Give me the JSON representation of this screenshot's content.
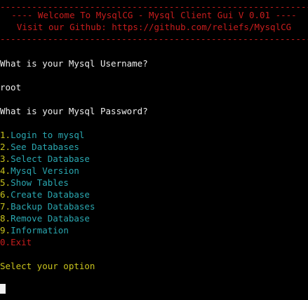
{
  "banner": {
    "rule_top": "------------------------------------------------------------",
    "welcome": "---- Welcome To MysqlCG - Mysql Client Gui V 0.01 ----",
    "github": "Visit our Github: https://github.com/reliefs/MysqlCG",
    "rule_bottom": "------------------------------------------------------------"
  },
  "prompts": {
    "username_question": "What is your Mysql Username?",
    "username_answer": "root",
    "password_question": "What is your Mysql Password?"
  },
  "menu": [
    {
      "num": "1.",
      "label": "Login to mysql"
    },
    {
      "num": "2.",
      "label": "See Databases"
    },
    {
      "num": "3.",
      "label": "Select Database"
    },
    {
      "num": "4.",
      "label": "Mysql Version"
    },
    {
      "num": "5.",
      "label": "Show Tables"
    },
    {
      "num": "6.",
      "label": "Create Database"
    },
    {
      "num": "7.",
      "label": "Backup Databases"
    },
    {
      "num": "8.",
      "label": "Remove Database"
    },
    {
      "num": "9.",
      "label": "Information"
    },
    {
      "num": "0.",
      "label": "Exit"
    }
  ],
  "select_prompt": "Select your option",
  "colors": {
    "background": "#000000",
    "banner": "#c81d1d",
    "text": "#eeeeee",
    "number": "#c8c21d",
    "option": "#2aa7b0",
    "exit": "#c81d1d"
  }
}
